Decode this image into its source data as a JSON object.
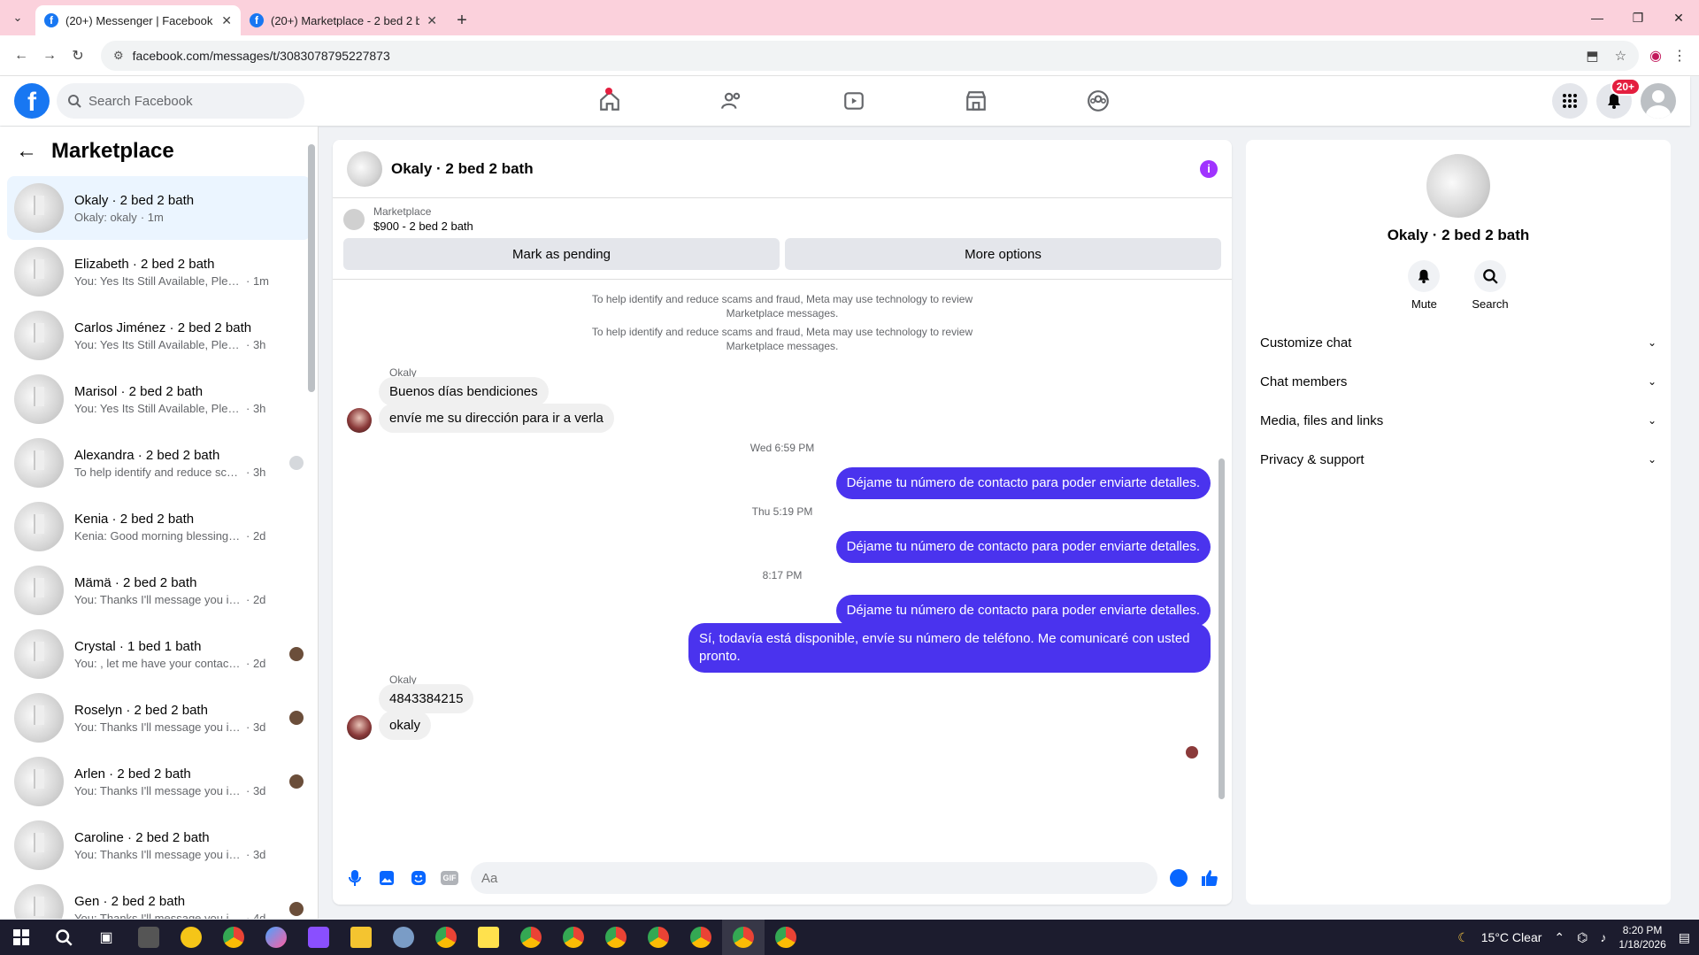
{
  "browser": {
    "tabs": [
      {
        "title": "(20+) Messenger | Facebook",
        "active": true
      },
      {
        "title": "(20+) Marketplace - 2 bed 2 ba",
        "active": false
      }
    ],
    "url": "facebook.com/messages/t/3083078795227873"
  },
  "fbnav": {
    "logo": "f",
    "search_placeholder": "Search Facebook",
    "notifications_badge": "20+"
  },
  "left": {
    "title": "Marketplace",
    "conversations": [
      {
        "name": "Okaly · 2 bed 2 bath",
        "preview": "Okaly: okaly",
        "time": "· 1m",
        "selected": true,
        "mini": ""
      },
      {
        "name": "Elizabeth · 2 bed 2 bath",
        "preview": "You: Yes Its Still Available, Please S...",
        "time": "· 1m",
        "mini": ""
      },
      {
        "name": "Carlos Jiménez · 2 bed 2 bath",
        "preview": "You: Yes Its Still Available, Please Se...",
        "time": "· 3h",
        "mini": ""
      },
      {
        "name": "Marisol · 2 bed 2 bath",
        "preview": "You: Yes Its Still Available, Please Se...",
        "time": "· 3h",
        "mini": ""
      },
      {
        "name": "Alexandra · 2 bed 2 bath",
        "preview": "To help identify and reduce sca...",
        "time": "· 3h",
        "mini": "gray"
      },
      {
        "name": "Kenia · 2 bed 2 bath",
        "preview": "Kenia: Good morning blessings, I a...",
        "time": "· 2d",
        "mini": ""
      },
      {
        "name": "Mämä · 2 bed 2 bath",
        "preview": "You: Thanks I'll message you in a m...",
        "time": "· 2d",
        "mini": ""
      },
      {
        "name": "Crystal · 1 bed 1 bath",
        "preview": "You: , let me have your contact n...",
        "time": "· 2d",
        "mini": "dark"
      },
      {
        "name": "Roselyn · 2 bed 2 bath",
        "preview": "You: Thanks I'll message you in ...",
        "time": "· 3d",
        "mini": "dark"
      },
      {
        "name": "Arlen · 2 bed 2 bath",
        "preview": "You: Thanks I'll message you in ...",
        "time": "· 3d",
        "mini": "dark"
      },
      {
        "name": "Caroline · 2 bed 2 bath",
        "preview": "You: Thanks I'll message you in a m...",
        "time": "· 3d",
        "mini": ""
      },
      {
        "name": "Gen · 2 bed 2 bath",
        "preview": "You: Thanks I'll message you in ...",
        "time": "· 4d",
        "mini": "dark"
      }
    ]
  },
  "chat": {
    "title": "Okaly · 2 bed 2 bath",
    "listing_source": "Marketplace",
    "listing_title": "$900 - 2 bed 2 bath",
    "mark_pending": "Mark as pending",
    "more_options": "More options",
    "notice": "To help identify and reduce scams and fraud, Meta may use technology to review Marketplace messages.",
    "sender": "Okaly",
    "msg_in_1": "Buenos días bendiciones",
    "msg_in_2": "envíe me su dirección para ir a verla",
    "ts_1": "Wed 6:59 PM",
    "msg_out_1": "Déjame tu número de contacto para poder enviarte detalles.",
    "ts_2": "Thu 5:19 PM",
    "msg_out_2": "Déjame tu número de contacto para poder enviarte detalles.",
    "ts_3": "8:17 PM",
    "msg_out_3": "Déjame tu número de contacto para poder enviarte detalles.",
    "msg_out_4": "Sí, todavía está disponible, envíe su número de teléfono. Me comunicaré con usted pronto.",
    "msg_in_3": "4843384215",
    "msg_in_4": "okaly",
    "composer_placeholder": "Aa"
  },
  "right": {
    "title": "Okaly · 2 bed 2 bath",
    "mute": "Mute",
    "search": "Search",
    "sections": [
      "Customize chat",
      "Chat members",
      "Media, files and links",
      "Privacy & support"
    ]
  },
  "taskbar": {
    "weather": "15°C  Clear",
    "time": "8:20 PM",
    "date": "1/18/2026"
  },
  "colors": {
    "fb_blue": "#1877f2",
    "out_bubble": "#4a33ee",
    "selected_row": "#ebf5ff",
    "badge_red": "#e41e3f"
  }
}
